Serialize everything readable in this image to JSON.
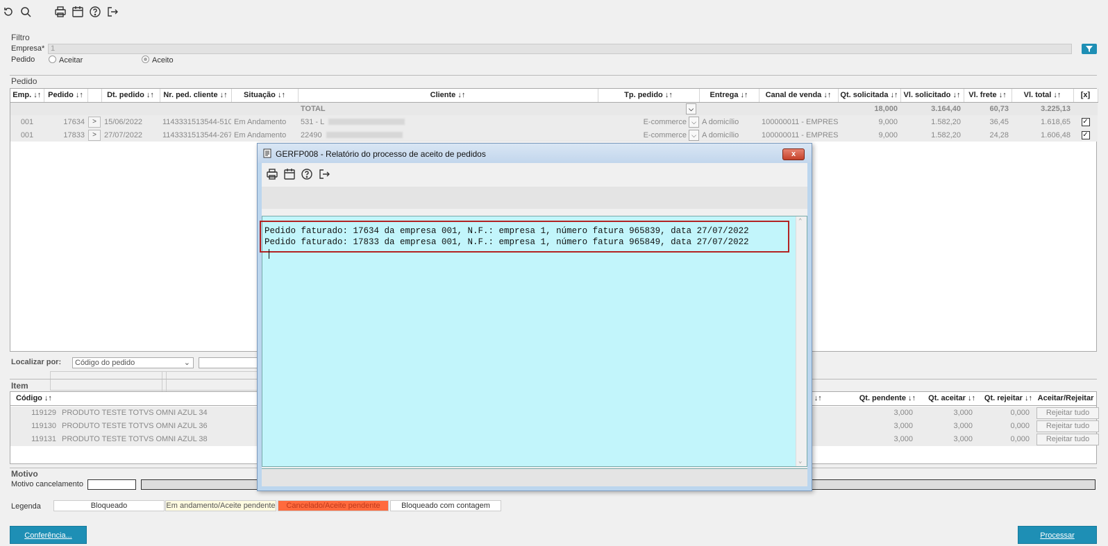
{
  "toolbar": {
    "icons": [
      "undo-icon",
      "search-icon",
      "print-icon",
      "calendar-icon",
      "help-icon",
      "exit-icon"
    ]
  },
  "filtro": {
    "title": "Filtro",
    "empresa_label": "Empresa*",
    "empresa_value": "1",
    "pedido_label": "Pedido",
    "radio_aceitar": "Aceitar",
    "radio_aceito": "Aceito"
  },
  "pedido": {
    "title": "Pedido",
    "headers": [
      "Emp. ↓↑",
      "Pedido ↓↑",
      "",
      "Dt. pedido ↓↑",
      "Nr. ped. cliente ↓↑",
      "Situação ↓↑",
      "Cliente ↓↑",
      "Tp. pedido ↓↑",
      "Entrega ↓↑",
      "Canal de venda ↓↑",
      "Qt. solicitada ↓↑",
      "Vl. solicitado ↓↑",
      "Vl. frete ↓↑",
      "Vl. total ↓↑",
      "[x]"
    ],
    "total": {
      "label": "TOTAL",
      "qt_solicitada": "18,000",
      "vl_solicitado": "3.164,40",
      "vl_frete": "60,73",
      "vl_total": "3.225,13"
    },
    "rows": [
      {
        "emp": "001",
        "pedido": "17634",
        "btn": ">",
        "dt": "15/06/2022",
        "nr": "1143331513544-510",
        "situacao": "Em Andamento",
        "cliente": "531 - L",
        "tp": "E-commerce",
        "entrega": "A domicílio",
        "canal": "100000011 - EMPRES/",
        "qt": "9,000",
        "vl": "1.582,20",
        "frete": "36,45",
        "total": "1.618,65",
        "check": "✓"
      },
      {
        "emp": "001",
        "pedido": "17833",
        "btn": ">",
        "dt": "27/07/2022",
        "nr": "1143331513544-267",
        "situacao": "Em Andamento",
        "cliente": "22490",
        "tp": "E-commerce",
        "entrega": "A domicílio",
        "canal": "100000011 - EMPRES/",
        "qt": "9,000",
        "vl": "1.582,20",
        "frete": "24,28",
        "total": "1.606,48",
        "check": "✓"
      }
    ]
  },
  "localizar": {
    "label": "Localizar por:",
    "selected": "Código do pedido"
  },
  "item": {
    "title": "Item",
    "headers_left": [
      "Código ↓↑"
    ],
    "headers_right": [
      "Qt. pendente ↓↑",
      "Qt. aceitar ↓↑",
      "Qt. rejeitar ↓↑",
      "Aceitar/Rejeitar"
    ],
    "partial_header": "o ↓↑",
    "rows": [
      {
        "codigo": "119129",
        "descricao": "PRODUTO TESTE TOTVS OMNI AZUL 34",
        "pendente": "3,000",
        "aceitar": "3,000",
        "rejeitar": "0,000",
        "acao": "Rejeitar tudo"
      },
      {
        "codigo": "119130",
        "descricao": "PRODUTO TESTE TOTVS OMNI AZUL 36",
        "pendente": "3,000",
        "aceitar": "3,000",
        "rejeitar": "0,000",
        "acao": "Rejeitar tudo"
      },
      {
        "codigo": "119131",
        "descricao": "PRODUTO TESTE TOTVS OMNI AZUL 38",
        "pendente": "3,000",
        "aceitar": "3,000",
        "rejeitar": "0,000",
        "acao": "Rejeitar tudo"
      }
    ]
  },
  "motivo": {
    "title": "Motivo",
    "label": "Motivo cancelamento"
  },
  "legenda": {
    "label": "Legenda",
    "items": [
      {
        "text": "Bloqueado",
        "bg": "#ffffff",
        "color": "#333333"
      },
      {
        "text": "Em andamento/Aceite pendente",
        "bg": "#fffbe0",
        "color": "#555555"
      },
      {
        "text": "Cancelado/Aceite pendente",
        "bg": "#ff6a3d",
        "color": "#c0391b"
      },
      {
        "text": "Bloqueado com contagem",
        "bg": "#ffffff",
        "color": "#333333"
      }
    ]
  },
  "buttons": {
    "conferencia": "Conferência...",
    "processar": "Processar"
  },
  "modal": {
    "title": "GERFP008 - Relatório do processo de aceito de pedidos",
    "close": "x",
    "lines": [
      "Pedido faturado: 17634 da empresa 001, N.F.: empresa 1, número fatura 965839, data 27/07/2022",
      "Pedido faturado: 17833 da empresa 001, N.F.: empresa 1, número fatura 965849, data 27/07/2022"
    ]
  },
  "colors": {
    "accent": "#1e8fb5",
    "modal_text_bg": "#c2f5fb",
    "highlight_border": "#b22222"
  }
}
